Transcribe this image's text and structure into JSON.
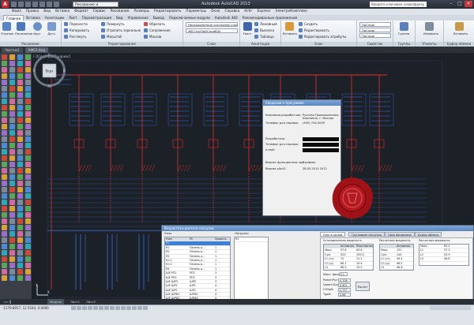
{
  "titlebar": {
    "workspace": "Рисование и аннотации",
    "title": "Autodesk AutoCAD 2013",
    "search_placeholder": "Введите ключевое слово/фразу"
  },
  "menu": [
    "Файл",
    "Правка",
    "Вид",
    "Вставка",
    "Формат",
    "Сервис",
    "Рисование",
    "Размеры",
    "Редактировать",
    "Параметры",
    "Окно",
    "Справка",
    "Кгбг",
    "Express",
    "ЭлектроКомплекс"
  ],
  "tabs": [
    "Главная",
    "Вставка",
    "Аннотации",
    "Лист",
    "Параметризация",
    "Вид",
    "Управление",
    "Вывод",
    "Подключаемые модули",
    "Autodesk 360",
    "Рекомендованные приложения"
  ],
  "ribbon": {
    "draw": {
      "label": "Рисование",
      "buttons": [
        "Отрезок",
        "Полилиния",
        "Круг",
        "Дуга"
      ]
    },
    "modify": {
      "label": "Редактирование",
      "buttons": [
        "Перенести",
        "Повернуть",
        "Обрезать",
        "Копировать",
        "Отразить зеркально",
        "Сопряжение",
        "Растянуть",
        "Масштаб",
        "Массив"
      ]
    },
    "layers": {
      "label": "Слои",
      "dropdowns": [
        "Несохраненное состояние слоя",
        "ЖЕСтруПоЦСприбЗо"
      ]
    },
    "annotation": {
      "label": "Аннотации",
      "buttons": [
        "Текст",
        "Линейный",
        "Выноска",
        "Таблица"
      ]
    },
    "block": {
      "label": "Блок",
      "buttons": [
        "Вставить",
        "Создать",
        "Редактировать",
        "Редактировать атрибуты"
      ]
    },
    "properties": {
      "label": "Свойства",
      "dropdowns": [
        "ПоСлою",
        "ПоСлою",
        "ПоСлою"
      ]
    },
    "groups": {
      "label": "Группы",
      "buttons": [
        "Группа"
      ]
    },
    "utilities": {
      "label": "Утилиты",
      "buttons": [
        "Измерить"
      ]
    },
    "clipboard": {
      "label": "Буфер обмена",
      "buttons": [
        "Вставить"
      ]
    }
  },
  "doc_tabs": [
    "Чертеж1",
    "КФЕЗ.dwg"
  ],
  "viewport_label": "[-][Сверху][2D-каркас]",
  "navcube": {
    "top": "С",
    "center": "Верх",
    "bottom": "Ю",
    "left": "З",
    "right": "В"
  },
  "info_dialog": {
    "title": "Сведения о программе",
    "rows": [
      {
        "k": "Компания-разработчик:",
        "v": "Русская Промышленная Компания, г. Москва"
      },
      {
        "k": "Телефон для справок:",
        "v": "(495) 744-0059"
      },
      {
        "k": "Разработчик:",
        "v": ""
      },
      {
        "k": "Телефон для справок:",
        "v": ""
      },
      {
        "k": "e-mail:",
        "v": ""
      },
      {
        "k": "Версия функционала программы:",
        "v": "3"
      },
      {
        "k": "Версия sAsLE:",
        "v": "28.05.2013 2012"
      }
    ]
  },
  "results_dialog": {
    "title": "Результаты расчета нагрузок",
    "tables": {
      "nodes": {
        "title": "Узлы",
        "headers": [
          "Узел",
          "РУ",
          "Уровень"
        ],
        "rows": [
          [
            "Р1",
            "",
            ""
          ],
          [
            "Я1",
            "Панель р...",
            "1"
          ],
          [
            "Я2",
            "Панель р...",
            "1"
          ],
          [
            "Я3",
            "Панель р...",
            "1"
          ],
          [
            "Кл 1",
            "Панель р...",
            "1"
          ],
          [
            "Кл 2",
            "Панель р...",
            "1"
          ],
          [
            "Я4",
            "Панель р...",
            "1"
          ],
          [
            "ШЕ РП1",
            "РП1",
            "3"
          ],
          [
            "ШЕ РП2",
            "РП2",
            "3"
          ],
          [
            "ШЕ ШРП",
            "ШРП",
            "3"
          ],
          [
            "ШЕ ШР1",
            "ШР1",
            "4"
          ],
          [
            "ШЕ ШР2",
            "ШР2",
            "4"
          ],
          [
            "ШЕ ШРФ1",
            "ШРФ1",
            "4"
          ],
          [
            "ШЕ ШРФ2",
            "ШРФ2",
            "4"
          ]
        ]
      },
      "loads_title": "Нагрузки",
      "load_value": "Я1"
    },
    "subtabs": [
      "Узел в целом",
      "Групповые нагрузки",
      "Своя фазировка",
      "Буфер обмена"
    ],
    "summary": {
      "installed_title": "Установленная мощность",
      "installed_cols": [
        "",
        "Активная",
        "Реактивная"
      ],
      "installed_rows": [
        [
          "Макс.",
          "97.8",
          "63.6"
        ],
        [
          "Сум.",
          "203",
          "159.3"
        ],
        [
          "L1 (Lx)",
          "72",
          "21.2"
        ],
        [
          "L2 (Ly)",
          "66.1",
          "19.4"
        ],
        [
          "L3",
          "66.5",
          "19.5"
        ]
      ],
      "phase_label": "Макс. фаза",
      "phase_value": "L1",
      "factors": [
        {
          "k": "Ркват/Руст",
          "v": "0.706"
        },
        {
          "k": "Qкват/Qуст",
          "v": "0.601"
        },
        {
          "k": "COSphi",
          "v": "0.757"
        },
        {
          "k": "Tgphi",
          "v": "0.88"
        }
      ],
      "calc_button": "Расчет",
      "calc_title": "Расчетная мощность",
      "calc_cols": [
        "",
        "Активная"
      ],
      "calc_rows": [
        [
          "Макс.",
          "151"
        ],
        [
          "Сум.",
          "144"
        ],
        [
          "L1 (Lx)",
          "49.4"
        ],
        [
          "L2 (Ly)",
          "46.5"
        ],
        [
          "L3",
          "48.6"
        ]
      ],
      "calc2_title": "Расчетная мощность",
      "calc2_rows": [
        [
          "Макс.",
          "65.2"
        ],
        [
          "L1",
          "57.3"
        ],
        [
          "L2",
          "53.9"
        ],
        [
          "L3",
          "56.8"
        ]
      ]
    }
  },
  "statusbar": {
    "coords": "-1179.8917, 12.5544, 0.0000",
    "tabs": [
      "Модель",
      "Лист1",
      "Лист2"
    ]
  },
  "colors": {
    "accent": "#c8292f",
    "wire": "#e0302c",
    "lines": "#3c6fe8",
    "selection": "#3d7fd6"
  }
}
